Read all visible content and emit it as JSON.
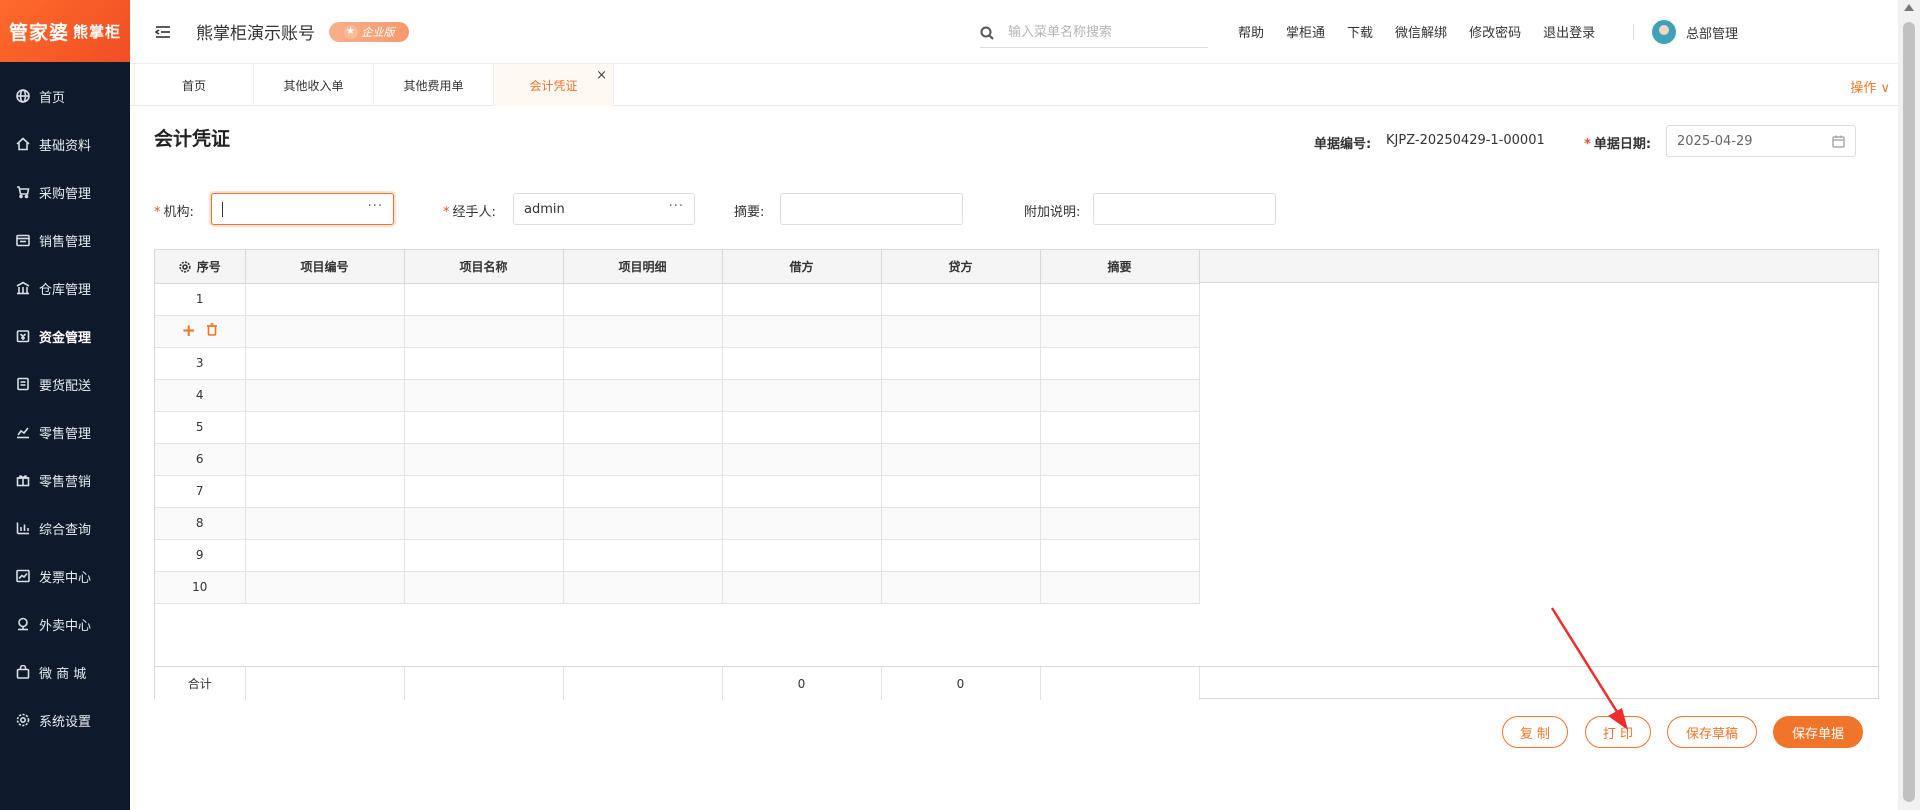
{
  "brand": {
    "logo_main": "管家婆",
    "logo_sub": "熊掌柜"
  },
  "header": {
    "account_title": "熊掌柜演示账号",
    "edition_badge": "企业版",
    "search_placeholder": "输入菜单名称搜索",
    "links": [
      "帮助",
      "掌柜通",
      "下载",
      "微信解绑",
      "修改密码",
      "退出登录"
    ],
    "user_name": "总部管理"
  },
  "sidebar": {
    "items": [
      {
        "label": "首页",
        "icon": "globe-icon"
      },
      {
        "label": "基础资料",
        "icon": "home-icon"
      },
      {
        "label": "采购管理",
        "icon": "cart-icon"
      },
      {
        "label": "销售管理",
        "icon": "sales-icon"
      },
      {
        "label": "仓库管理",
        "icon": "warehouse-icon"
      },
      {
        "label": "资金管理",
        "icon": "finance-icon"
      },
      {
        "label": "要货配送",
        "icon": "delivery-icon"
      },
      {
        "label": "零售管理",
        "icon": "retail-chart-icon"
      },
      {
        "label": "零售营销",
        "icon": "gift-icon"
      },
      {
        "label": "综合查询",
        "icon": "bar-chart-icon"
      },
      {
        "label": "发票中心",
        "icon": "trend-icon"
      },
      {
        "label": "外卖中心",
        "icon": "takeout-icon"
      },
      {
        "label": "微 商 城",
        "icon": "bag-icon"
      },
      {
        "label": "系统设置",
        "icon": "gear-icon"
      }
    ],
    "active_index": 5
  },
  "tabs": {
    "items": [
      "首页",
      "其他收入单",
      "其他费用单",
      "会计凭证"
    ],
    "active_index": 3,
    "close_symbol": "×",
    "actions_label": "操作 ∨"
  },
  "form": {
    "title": "会计凭证",
    "doc_no_label": "单据编号:",
    "doc_no_value": "KJPZ-20250429-1-00001",
    "doc_date_label": "单据日期:",
    "doc_date_value": "2025-04-29",
    "org_label": "机构:",
    "org_value": "",
    "handler_label": "经手人:",
    "handler_value": "admin",
    "summary_label": "摘要:",
    "summary_value": "",
    "note_label": "附加说明:",
    "note_value": "",
    "required_mark": "*",
    "dots": "···"
  },
  "table": {
    "columns": [
      "序号",
      "项目编号",
      "项目名称",
      "项目明细",
      "借方",
      "贷方",
      "摘要"
    ],
    "rows": [
      "1",
      "",
      "3",
      "4",
      "5",
      "6",
      "7",
      "8",
      "9",
      "10"
    ],
    "hover_row_index": 1,
    "total_label": "合计",
    "total_debit": "0",
    "total_credit": "0"
  },
  "actions": {
    "copy": "复 制",
    "print": "打 印",
    "save_draft": "保存草稿",
    "save": "保存单据"
  },
  "colors": {
    "accent": "#f0742a",
    "sidebar_bg": "#0e1a2b",
    "annotation": "#f02d2d"
  }
}
